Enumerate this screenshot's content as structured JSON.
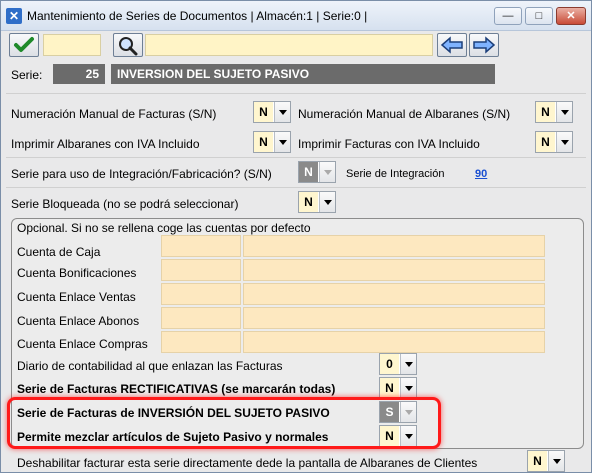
{
  "window": {
    "title": "Mantenimiento de Series de Documentos   | Almacén:1 | Serie:0 |",
    "min_label": "—",
    "max_label": "□",
    "close_label": "✕"
  },
  "serie": {
    "label": "Serie:",
    "number": "25",
    "name": "INVERSION DEL SUJETO PASIVO"
  },
  "options": {
    "num_manual_facturas": {
      "label": "Numeración Manual de Facturas (S/N)",
      "value": "N"
    },
    "num_manual_albaranes": {
      "label": "Numeración Manual de Albaranes (S/N)",
      "value": "N"
    },
    "imprimir_albaranes_iva": {
      "label": "Imprimir Albaranes con IVA Incluido",
      "value": "N"
    },
    "imprimir_facturas_iva": {
      "label": "Imprimir Facturas con IVA Incluido",
      "value": "N"
    },
    "integracion": {
      "label": "Serie para uso de Integración/Fabricación? (S/N)",
      "value": "N"
    },
    "serie_integracion": {
      "label": "Serie de Integración",
      "value": "90"
    },
    "bloqueada": {
      "label": "Serie Bloqueada (no se podrá seleccionar)",
      "value": "N"
    }
  },
  "cuentas": {
    "header": "Opcional. Si no se rellena coge las cuentas por defecto",
    "items": [
      {
        "label": "Cuenta de Caja"
      },
      {
        "label": "Cuenta Bonificaciones"
      },
      {
        "label": "Cuenta Enlace Ventas"
      },
      {
        "label": "Cuenta Enlace Abonos"
      },
      {
        "label": "Cuenta Enlace Compras"
      }
    ],
    "diario": {
      "label": "Diario de contabilidad al que enlazan las Facturas",
      "value": "0"
    },
    "rectificativas": {
      "label": "Serie de Facturas RECTIFICATIVAS (se marcarán todas)",
      "value": "N"
    },
    "inversion": {
      "label": "Serie de Facturas de INVERSIÓN DEL SUJETO PASIVO",
      "value": "S"
    },
    "mezclar": {
      "label": "Permite mezclar artículos de Sujeto Pasivo y normales",
      "value": "N"
    }
  },
  "deshabilitar": {
    "label": "Deshabilitar facturar esta serie directamente dede la pantalla de Albaranes de Clientes",
    "value": "N"
  },
  "colors": {
    "accent_red": "#ff1a1a",
    "field_yellow": "#fff4c6",
    "serie_gray": "#6b6b6b"
  }
}
